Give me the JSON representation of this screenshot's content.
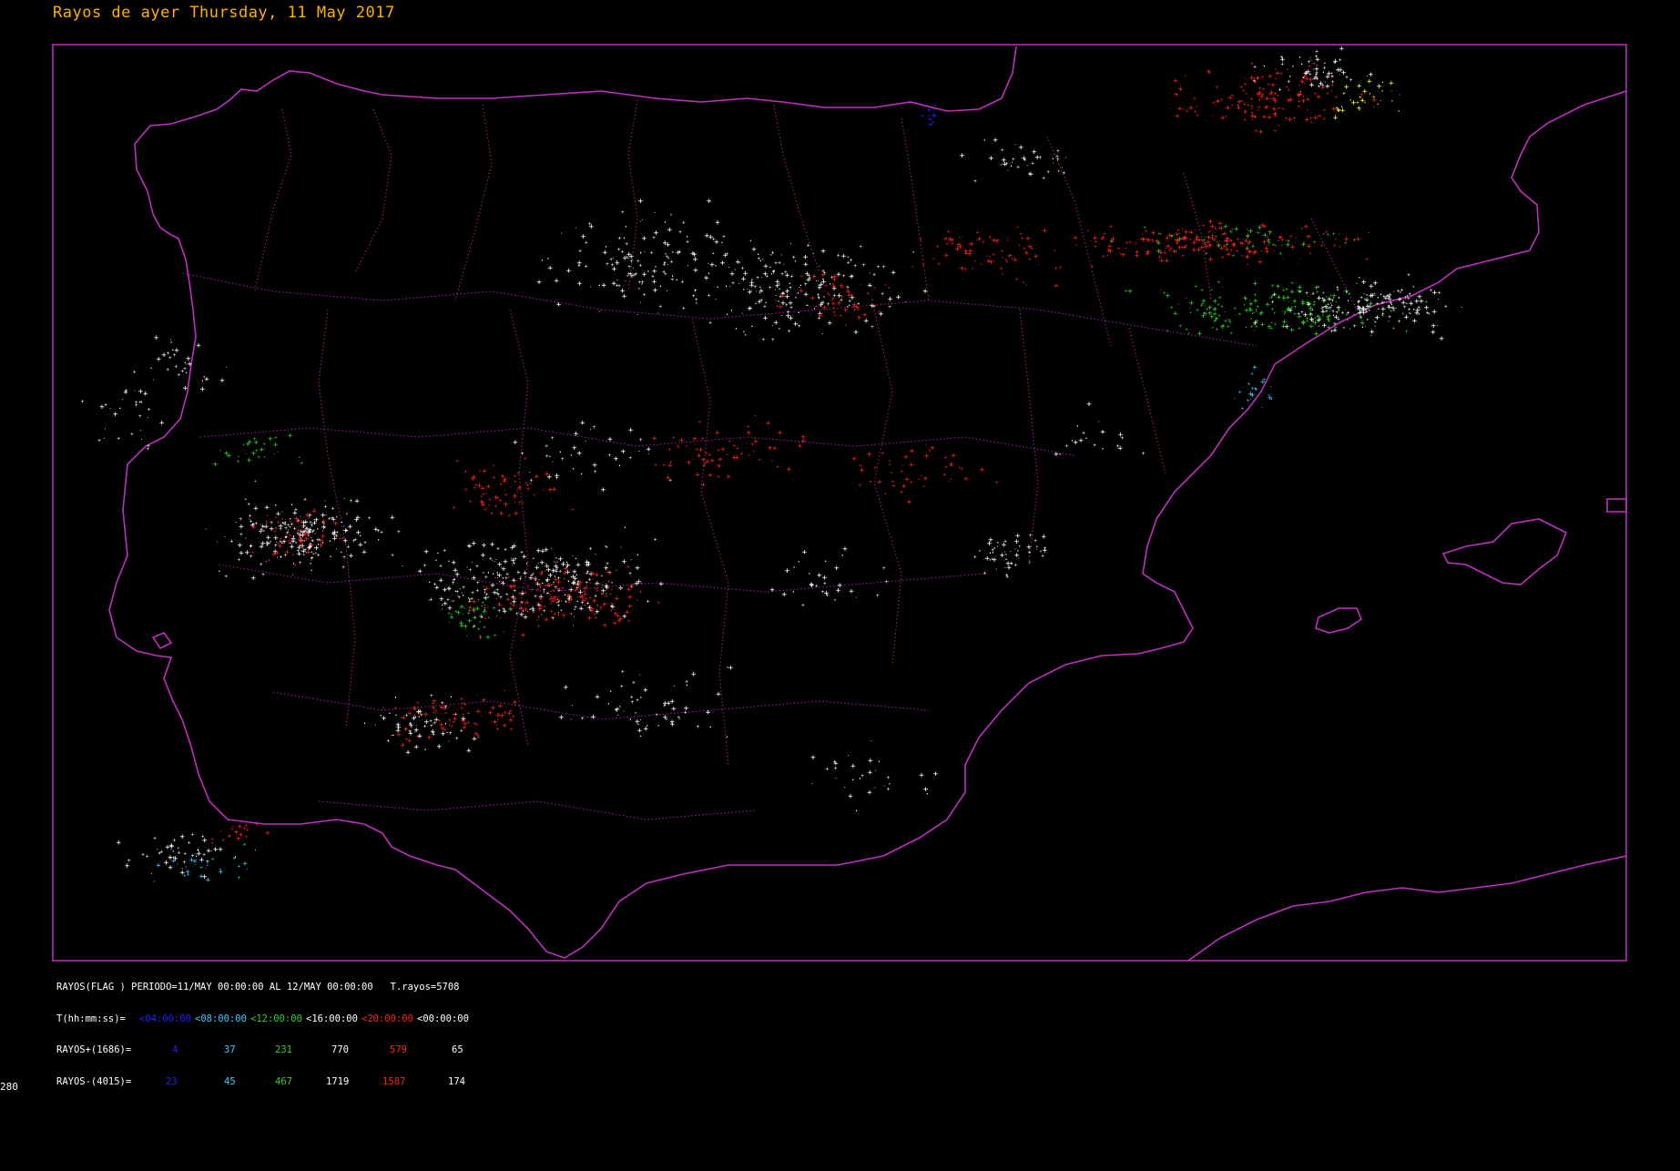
{
  "title": "Rayos de ayer Thursday, 11 May 2017",
  "colors": {
    "frame": "#c030c0",
    "coast": "#c030c0",
    "borders": "#a020a0",
    "bin_0": "#2020ff",
    "bin_1": "#40c8ff",
    "bin_2": "#30d030",
    "bin_3": "#ffffff",
    "bin_4": "#ff2020",
    "bin_5": "#ffff40",
    "title": "#ffb000"
  },
  "stats": {
    "line1": "RAYOS(FLAG ) PERIODO=11/MAY 00:00:00 AL 12/MAY 00:00:00   T.rayos=5708",
    "time_label": "T(hh:mm:ss)=",
    "time_bins": [
      "<04:00:00",
      "<08:00:00",
      "<12:00:00",
      "<16:00:00",
      "<20:00:00",
      "<00:00:00"
    ],
    "pos_label": "RAYOS+(1686)=",
    "pos_values": [
      "4",
      "37",
      "231",
      "770",
      "579",
      "65"
    ],
    "neg_label": "RAYOS-(4015)=",
    "neg_values": [
      "23",
      "45",
      "467",
      "1719",
      "1587",
      "174"
    ]
  },
  "footer_number": "280"
}
